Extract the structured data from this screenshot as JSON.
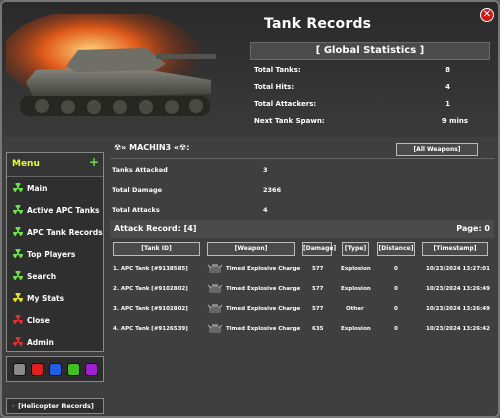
{
  "window": {
    "title": "Tank Records",
    "close_glyph": "✕"
  },
  "global_stats": {
    "heading": "[ Global Statistics ]",
    "rows": [
      {
        "label": "Total Tanks:",
        "value": "8"
      },
      {
        "label": "Total Hits:",
        "value": "4"
      },
      {
        "label": "Total Attackers:",
        "value": "1"
      },
      {
        "label": "Next Tank Spawn:",
        "value": "9 mins"
      }
    ]
  },
  "menu": {
    "title": "Menu",
    "add_glyph": "+",
    "items": [
      {
        "label": "Main",
        "icon": "radiation-icon",
        "color": "#6fe04a"
      },
      {
        "label": "Active APC Tanks",
        "icon": "radiation-icon",
        "color": "#6fe04a"
      },
      {
        "label": "APC Tank Records",
        "icon": "radiation-icon",
        "color": "#6fe04a"
      },
      {
        "label": "Top Players",
        "icon": "radiation-icon",
        "color": "#6fe04a"
      },
      {
        "label": "Search",
        "icon": "radiation-icon",
        "color": "#6fe04a"
      },
      {
        "label": "My Stats",
        "icon": "radiation-icon",
        "color": "#e6e02e"
      },
      {
        "label": "Close",
        "icon": "radiation-icon",
        "color": "#e03030"
      },
      {
        "label": "Admin",
        "icon": "radiation-icon",
        "color": "#e03030"
      }
    ],
    "swatches": [
      "#8a8a8a",
      "#e02020",
      "#2060e0",
      "#40c020",
      "#a020d0"
    ]
  },
  "helicopter_button": {
    "glyph": "◦",
    "label": "[Helicopter Records]"
  },
  "player": {
    "name": "☢» MACHIN3 «☢:",
    "filter_button": "[All Weapons]",
    "stats": [
      {
        "label": "Tanks Attacked",
        "value": "3"
      },
      {
        "label": "Total Damage",
        "value": "2366"
      },
      {
        "label": "Total Attacks",
        "value": "4"
      }
    ]
  },
  "attack_record": {
    "label": "Attack Record: [4]",
    "page": "Page: 0",
    "columns": [
      "[Tank ID]",
      "[Weapon]",
      "[Damage]",
      "[Type]",
      "[Distance]",
      "[Timestamp]"
    ],
    "rows": [
      {
        "tank": "1. APC Tank [#9138585]",
        "weapon": "Timed Explosive Charge",
        "damage": "577",
        "type": "Explosion",
        "distance": "0",
        "timestamp": "10/23/2024 13:27:01"
      },
      {
        "tank": "2. APC Tank [#9102802]",
        "weapon": "Timed Explosive Charge",
        "damage": "577",
        "type": "Explosion",
        "distance": "0",
        "timestamp": "10/23/2024 13:26:49"
      },
      {
        "tank": "3. APC Tank [#9102802]",
        "weapon": "Timed Explosive Charge",
        "damage": "577",
        "type": "Other",
        "distance": "0",
        "timestamp": "10/23/2024 13:26:49"
      },
      {
        "tank": "4. APC Tank [#9126539]",
        "weapon": "Timed Explosive Charge",
        "damage": "635",
        "type": "Explosion",
        "distance": "0",
        "timestamp": "10/23/2024 13:26:42"
      }
    ]
  }
}
